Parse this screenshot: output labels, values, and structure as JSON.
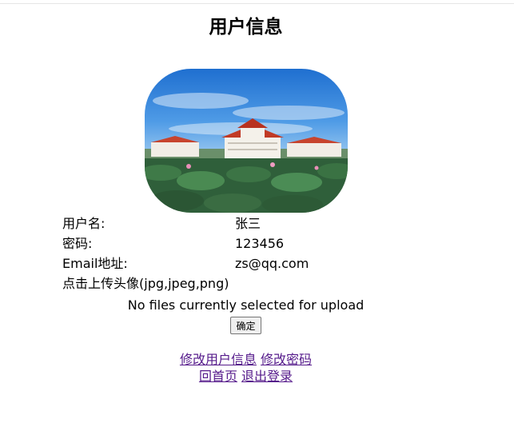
{
  "page": {
    "title": "用户信息"
  },
  "profile": {
    "fields": [
      {
        "label": "用户名:",
        "value": "张三"
      },
      {
        "label": "密码:",
        "value": "123456"
      },
      {
        "label": "Email地址:",
        "value": "zs@qq.com"
      }
    ],
    "upload_label": "点击上传头像(jpg,jpeg,png)",
    "file_status": "No files currently selected for upload",
    "confirm_label": "确定"
  },
  "links": {
    "edit_info": "修改用户信息",
    "change_password": "修改密码",
    "home": "回首页",
    "logout": "退出登录"
  },
  "colors": {
    "link_visited": "#551a8b",
    "sky": "#2f7fd8",
    "lotus_green": "#2f5f3a"
  }
}
